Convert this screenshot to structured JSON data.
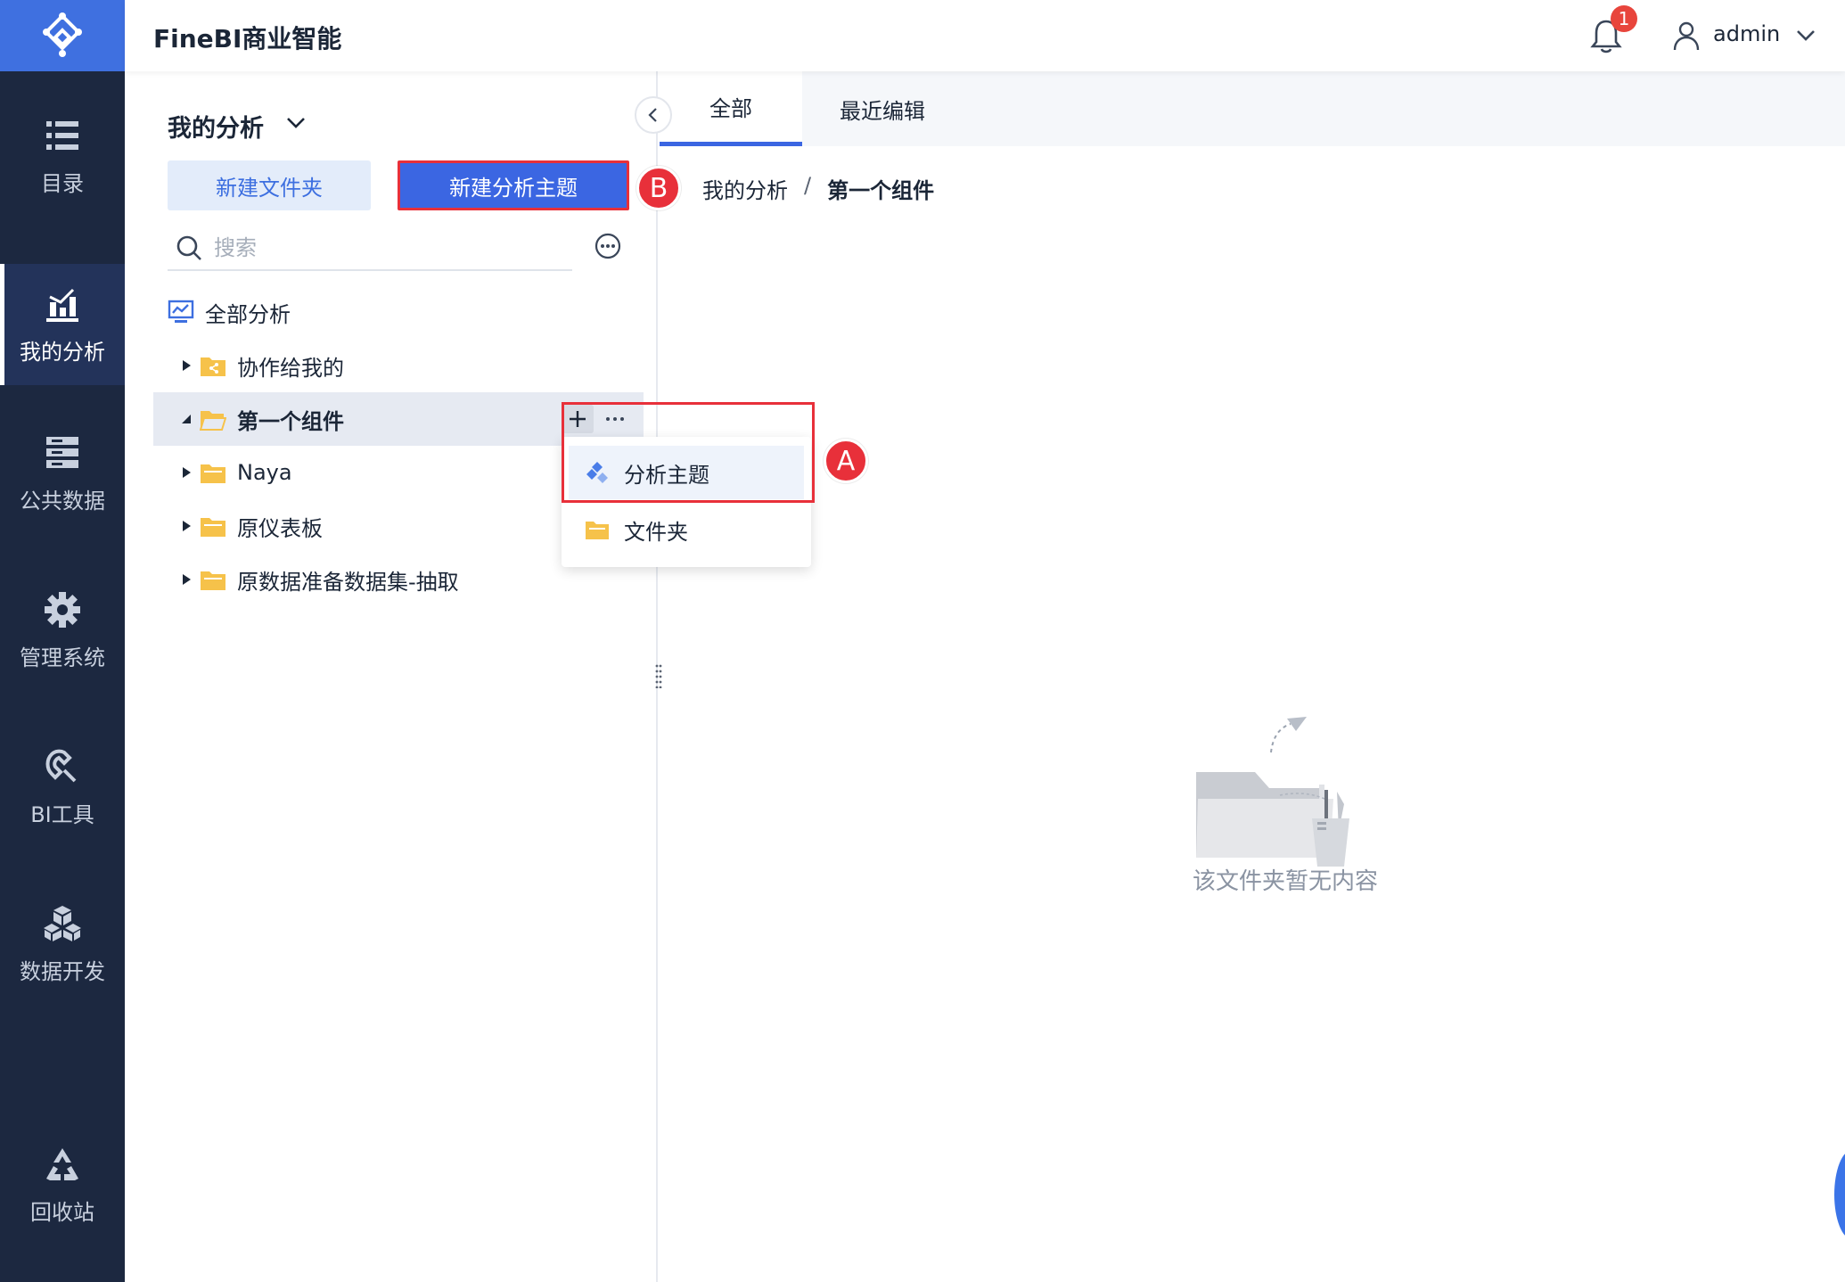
{
  "app": {
    "title": "FineBI商业智能"
  },
  "topbar": {
    "notification_count": "1",
    "username": "admin"
  },
  "rail": {
    "items": [
      {
        "label": "目录",
        "icon": "list-icon"
      },
      {
        "label": "我的分析",
        "icon": "bar-chart-icon",
        "active": true
      },
      {
        "label": "公共数据",
        "icon": "database-icon"
      },
      {
        "label": "管理系统",
        "icon": "gear-icon"
      },
      {
        "label": "BI工具",
        "icon": "tool-icon"
      },
      {
        "label": "数据开发",
        "icon": "cubes-icon"
      },
      {
        "label": "回收站",
        "icon": "recycle-icon"
      }
    ]
  },
  "panel": {
    "title": "我的分析",
    "new_folder_label": "新建文件夹",
    "new_subject_label": "新建分析主题",
    "search_placeholder": "搜索",
    "tree": [
      {
        "label": "全部分析",
        "type": "root"
      },
      {
        "label": "协作给我的",
        "type": "shared-folder"
      },
      {
        "label": "第一个组件",
        "type": "folder",
        "expanded": true,
        "selected": true
      },
      {
        "label": "Naya",
        "type": "folder"
      },
      {
        "label": "原仪表板",
        "type": "folder"
      },
      {
        "label": "原数据准备数据集-抽取",
        "type": "folder"
      }
    ]
  },
  "menu": {
    "items": [
      {
        "label": "分析主题",
        "icon": "analysis-subject-icon"
      },
      {
        "label": "文件夹",
        "icon": "folder-icon"
      }
    ]
  },
  "markers": {
    "a": "A",
    "b": "B"
  },
  "main": {
    "tabs": [
      {
        "label": "全部",
        "active": true
      },
      {
        "label": "最近编辑"
      }
    ],
    "breadcrumb": {
      "root": "我的分析",
      "separator": "/",
      "current": "第一个组件"
    },
    "empty_text": "该文件夹暂无内容"
  },
  "colors": {
    "rail_bg": "#1c2840",
    "brand_blue": "#3b66e2",
    "annotation_red": "#e8303a",
    "folder_yellow": "#f6c24a"
  }
}
